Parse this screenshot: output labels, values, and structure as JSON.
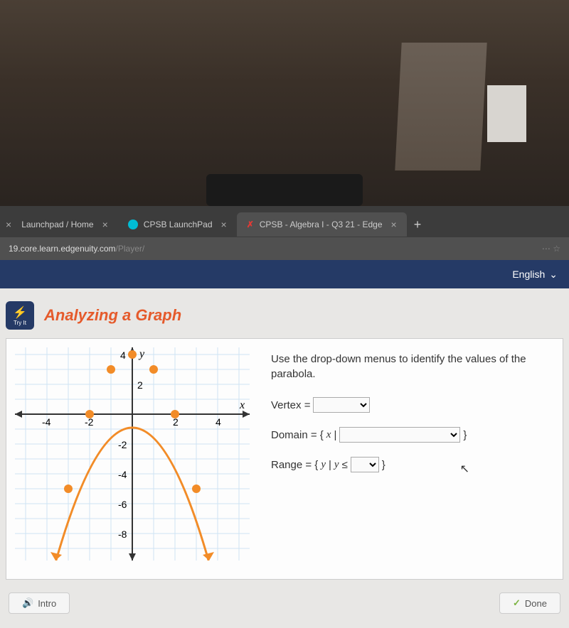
{
  "browser": {
    "tabs": [
      {
        "label": "Launchpad / Home",
        "icon": ""
      },
      {
        "label": "CPSB LaunchPad",
        "icon": "cyan"
      },
      {
        "label": "CPSB - Algebra I - Q3 21 - Edge",
        "icon": "red"
      }
    ],
    "new_tab": "+",
    "url_host": "19.core.learn.edgenuity.com",
    "url_path": "/Player/"
  },
  "topbar": {
    "language": "English"
  },
  "activity": {
    "badge_line1": "⚡",
    "badge_line2": "Try It",
    "title": "Analyzing a Graph"
  },
  "chart_data": {
    "type": "line",
    "title": "",
    "xlabel": "x",
    "ylabel": "y",
    "xlim": [
      -5,
      5
    ],
    "ylim": [
      -9,
      5
    ],
    "xticks": [
      -4,
      -2,
      2,
      4
    ],
    "yticks": [
      -8,
      -6,
      -4,
      -2,
      2,
      4
    ],
    "series": [
      {
        "name": "parabola",
        "color": "#f28c28",
        "x": [
          -3,
          -2,
          -1,
          0,
          1,
          2,
          3
        ],
        "y": [
          -5,
          0,
          3,
          4,
          3,
          0,
          -5
        ],
        "marked_points": [
          [
            -2,
            0
          ],
          [
            -1,
            3
          ],
          [
            0,
            4
          ],
          [
            1,
            3
          ],
          [
            2,
            0
          ],
          [
            -3,
            -5
          ],
          [
            3,
            -5
          ]
        ]
      }
    ]
  },
  "questions": {
    "instruction": "Use the drop-down menus to identify the values of the parabola.",
    "vertex_label": "Vertex =",
    "domain_prefix": "Domain = {",
    "domain_var": "x",
    "domain_mid": "| ",
    "domain_suffix": "}",
    "range_prefix": "Range = {",
    "range_var": "y",
    "range_mid": "| ",
    "range_var2": "y",
    "range_op": " ≤ ",
    "range_suffix": "}"
  },
  "footer": {
    "intro": "Intro",
    "done": "Done"
  }
}
